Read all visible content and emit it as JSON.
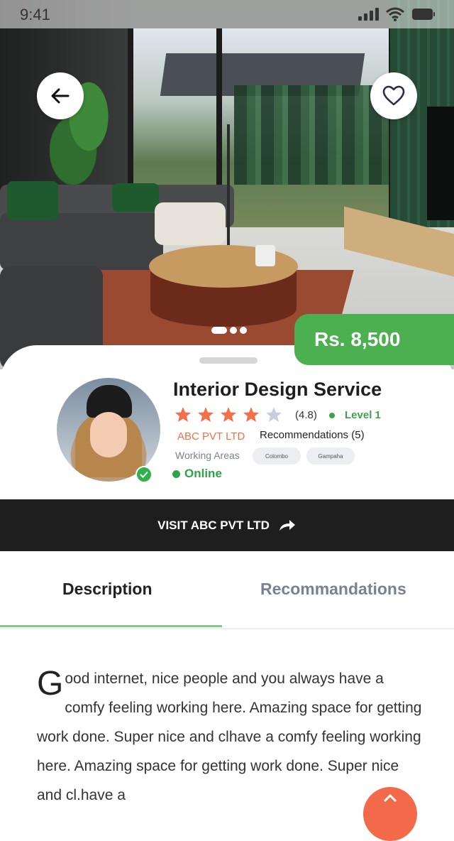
{
  "status_bar": {
    "time": "9:41"
  },
  "hero": {
    "back_icon": "arrow-left-icon",
    "favorite_icon": "heart-icon",
    "carousel_dots": 3,
    "active_dot": 0
  },
  "price": {
    "label": "Rs. 8,500",
    "color": "#4caf50"
  },
  "service": {
    "title": "Interior Design Service",
    "rating_value": 4,
    "rating_max": 5,
    "rating_text": "(4.8)",
    "level": "Level 1",
    "company": "ABC PVT LTD",
    "recommendations": "Recommendations (5)",
    "working_areas_label": "Working Areas",
    "working_areas": [
      "Colombo",
      "Gampaha"
    ],
    "status": "Online"
  },
  "visit_button": {
    "label": "VISIT ABC PVT LTD",
    "icon": "share-arrow-icon"
  },
  "tabs": [
    {
      "label": "Description",
      "active": true
    },
    {
      "label": "Recommandations",
      "active": false
    }
  ],
  "description": {
    "drop_cap": "G",
    "text": "ood internet, nice people and you always have a comfy feeling working here. Amazing space for getting work done. Super nice and clhave a comfy feeling working here. Amazing space for getting work done. Super nice and cl.have a"
  },
  "colors": {
    "accent_green": "#4caf50",
    "company_orange": "#f26f4a",
    "fab_orange": "#f26a4a",
    "star_filled": "#f26f4a",
    "star_empty": "#c8cfdc"
  }
}
